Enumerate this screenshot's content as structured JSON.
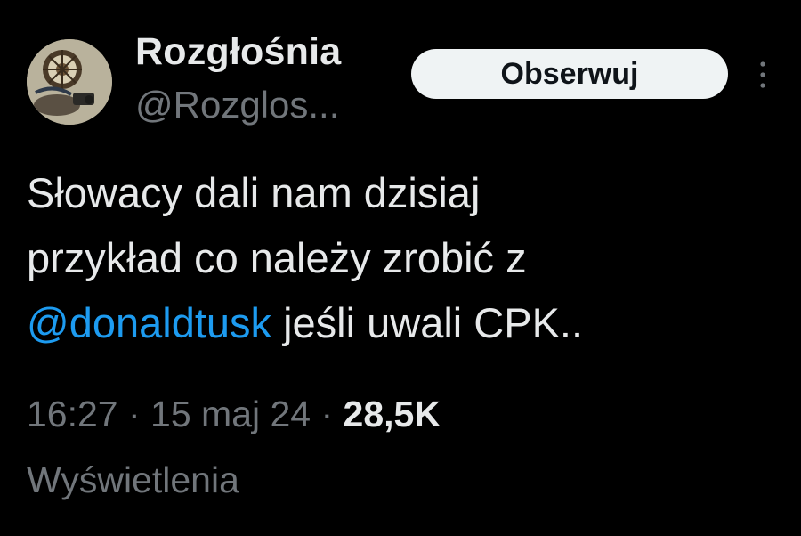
{
  "author": {
    "display_name": "Rozgłośnia",
    "handle": "@Rozglos..."
  },
  "follow_button": {
    "label": "Obserwuj"
  },
  "more_icon": "more-vertical-icon",
  "tweet": {
    "text_line1": "Słowacy dali nam dzisiaj",
    "text_line2": "przykład co należy zrobić z",
    "mention": "@donaldtusk",
    "text_line3_rest": " jeśli uwali CPK.."
  },
  "meta": {
    "time": "16:27",
    "separator1": " · ",
    "date": "15 maj 24",
    "separator2": " · ",
    "views_count": "28,5K",
    "views_label": "Wyświetlenia"
  },
  "colors": {
    "background": "#000000",
    "primary_text": "#e7e9ea",
    "secondary_text": "#71767b",
    "mention": "#1d9bf0",
    "button_bg": "#eff3f4",
    "button_text": "#0f1419"
  }
}
